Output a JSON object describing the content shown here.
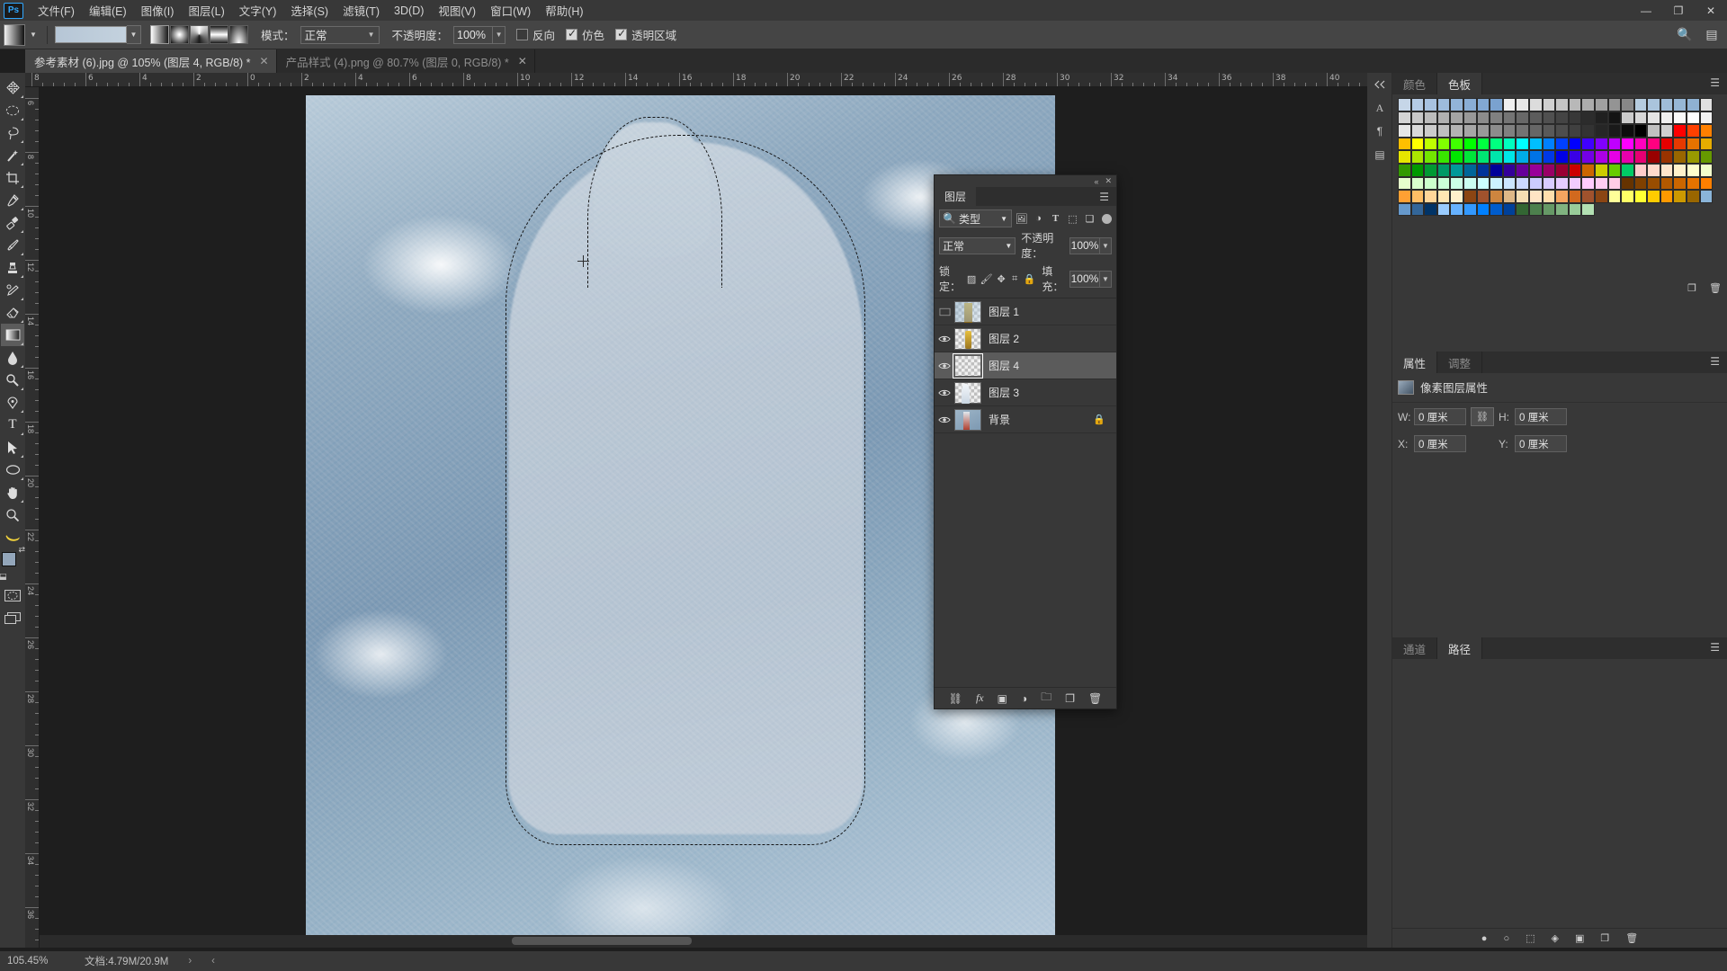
{
  "app": {
    "name": "Ps",
    "logo_color": "#31a8ff"
  },
  "menubar": {
    "items": [
      {
        "label": "文件(F)"
      },
      {
        "label": "编辑(E)"
      },
      {
        "label": "图像(I)"
      },
      {
        "label": "图层(L)"
      },
      {
        "label": "文字(Y)"
      },
      {
        "label": "选择(S)"
      },
      {
        "label": "滤镜(T)"
      },
      {
        "label": "3D(D)"
      },
      {
        "label": "视图(V)"
      },
      {
        "label": "窗口(W)"
      },
      {
        "label": "帮助(H)"
      }
    ],
    "window_controls": {
      "minimize": "—",
      "maximize": "❐",
      "close": "✕"
    }
  },
  "options_bar": {
    "tool": "gradient-tool",
    "mode_label": "模式：",
    "mode_value": "正常",
    "opacity_label": "不透明度：",
    "opacity_value": "100%",
    "checkboxes": [
      {
        "label": "反向",
        "checked": false
      },
      {
        "label": "仿色",
        "checked": true
      },
      {
        "label": "透明区域",
        "checked": true
      }
    ],
    "gradient_types": [
      "linear",
      "radial",
      "angle",
      "reflected",
      "diamond"
    ],
    "active_gradient_type": 0
  },
  "tabs": [
    {
      "title": "参考素材 (6).jpg @ 105% (图层 4, RGB/8) *",
      "active": true,
      "close": "✕"
    },
    {
      "title": "产品样式 (4).png @ 80.7% (图层 0, RGB/8) *",
      "active": false,
      "close": "✕"
    }
  ],
  "toolbar": {
    "tools": [
      {
        "name": "move-tool",
        "glyph": "✥"
      },
      {
        "name": "marquee-tool",
        "glyph": "◯"
      },
      {
        "name": "lasso-tool",
        "glyph": "◠"
      },
      {
        "name": "magic-wand-tool",
        "glyph": "✨"
      },
      {
        "name": "crop-tool",
        "glyph": "⌗"
      },
      {
        "name": "eyedropper-tool",
        "glyph": "✐"
      },
      {
        "name": "healing-brush-tool",
        "glyph": "✚"
      },
      {
        "name": "brush-tool",
        "glyph": "🖌"
      },
      {
        "name": "clone-stamp-tool",
        "glyph": "⚲"
      },
      {
        "name": "history-brush-tool",
        "glyph": "↯"
      },
      {
        "name": "eraser-tool",
        "glyph": "◨"
      },
      {
        "name": "gradient-tool",
        "glyph": "▦",
        "active": true
      },
      {
        "name": "blur-tool",
        "glyph": "💧"
      },
      {
        "name": "dodge-tool",
        "glyph": "◌"
      },
      {
        "name": "pen-tool",
        "glyph": "✒"
      },
      {
        "name": "type-tool",
        "glyph": "T"
      },
      {
        "name": "path-selection-tool",
        "glyph": "➤"
      },
      {
        "name": "ellipse-shape-tool",
        "glyph": "⬭"
      },
      {
        "name": "hand-tool",
        "glyph": "✋"
      },
      {
        "name": "zoom-tool",
        "glyph": "🔍"
      },
      {
        "name": "banana-tool",
        "glyph": "🍌"
      }
    ],
    "foreground_color": "#93a6ba",
    "background_color": "#b5b5b5"
  },
  "rulers": {
    "unit": "cm",
    "h_labels": [
      "6",
      "8",
      "10",
      "12",
      "14",
      "16",
      "18",
      "20",
      "22",
      "24",
      "26",
      "28",
      "30",
      "32",
      "34",
      "36",
      "38"
    ],
    "v_labels": [
      "6",
      "8",
      "10",
      "12",
      "14",
      "16",
      "18",
      "20",
      "22",
      "24",
      "26",
      "28",
      "30",
      "32",
      "34",
      "36"
    ]
  },
  "canvas": {
    "document": "参考素材 (6).jpg",
    "selection": "marching-ants-bottle-selection",
    "description": "ice texture background with bottle-shaped selection"
  },
  "color_panel": {
    "tabs": [
      {
        "label": "颜色",
        "active": false
      },
      {
        "label": "色板",
        "active": true
      }
    ],
    "swatch_rows": [
      [
        "#c6d6e8",
        "#b5cbe4",
        "#a8c2e0",
        "#9dbbdc",
        "#92b4d8",
        "#8aaed5",
        "#82a8d2",
        "#7aa2cf",
        "#f0f0f0",
        "#e8e8e8",
        "#dcdcdc",
        "#d0d0d0",
        "#c4c4c4",
        "#b8b8b8",
        "#acacac",
        "#a0a0a0",
        "#949494",
        "#888888",
        "#b6ccdf",
        "#aac4dc",
        "#a0bdd8",
        "#97b7d5",
        "#8fb1d2"
      ],
      [
        "#e0e0e0",
        "#d4d4d4",
        "#c8c8c8",
        "#bcbcbc",
        "#b0b0b0",
        "#a4a4a4",
        "#989898",
        "#8c8c8c",
        "#808080",
        "#747474",
        "#686868",
        "#5c5c5c",
        "#505050",
        "#444444",
        "#383838",
        "#2c2c2c",
        "#202020",
        "#141414",
        "#cccccc",
        "#d8d8d8",
        "#e4e4e4",
        "#f0f0f0",
        "#fafafa"
      ],
      [
        "#ffffff",
        "#f2f2f2",
        "#e6e6e6",
        "#d9d9d9",
        "#cccccc",
        "#bfbfbf",
        "#b3b3b3",
        "#a6a6a6",
        "#999999",
        "#8c8c8c",
        "#808080",
        "#737373",
        "#666666",
        "#595959",
        "#4d4d4d",
        "#404040",
        "#333333",
        "#262626",
        "#1a1a1a",
        "#0d0d0d",
        "#000000",
        "#c0c0c0",
        "#d0d0d0"
      ],
      [
        "#ff0000",
        "#ff4000",
        "#ff8000",
        "#ffbf00",
        "#ffff00",
        "#bfff00",
        "#80ff00",
        "#40ff00",
        "#00ff00",
        "#00ff40",
        "#00ff80",
        "#00ffbf",
        "#00ffff",
        "#00bfff",
        "#0080ff",
        "#0040ff",
        "#0000ff",
        "#4000ff",
        "#8000ff",
        "#bf00ff",
        "#ff00ff",
        "#ff00bf",
        "#ff0080"
      ],
      [
        "#e60000",
        "#e63900",
        "#e67300",
        "#e6ac00",
        "#e6e600",
        "#ace600",
        "#73e600",
        "#39e600",
        "#00e600",
        "#00e639",
        "#00e673",
        "#00e6ac",
        "#00e6e6",
        "#00ace6",
        "#0073e6",
        "#0039e6",
        "#0000e6",
        "#3900e6",
        "#7300e6",
        "#ac00e6",
        "#e600e6",
        "#e600ac",
        "#e60073"
      ],
      [
        "#990000",
        "#993300",
        "#996600",
        "#999900",
        "#669900",
        "#339900",
        "#009900",
        "#009933",
        "#009966",
        "#009999",
        "#006699",
        "#003399",
        "#000099",
        "#330099",
        "#660099",
        "#990099",
        "#990066",
        "#990033",
        "#cc0000",
        "#cc6600",
        "#cccc00",
        "#66cc00",
        "#00cc66"
      ],
      [
        "#ffcccc",
        "#ffd9cc",
        "#ffe6cc",
        "#fff2cc",
        "#ffffcc",
        "#f2ffcc",
        "#e6ffcc",
        "#d9ffcc",
        "#ccffcc",
        "#ccffd9",
        "#ccffe6",
        "#ccfff2",
        "#ccffff",
        "#ccf2ff",
        "#cce6ff",
        "#ccd9ff",
        "#ccccff",
        "#d9ccff",
        "#e6ccff",
        "#f2ccff",
        "#ffccff",
        "#ffccf2",
        "#ffcce6"
      ],
      [
        "#663300",
        "#804000",
        "#994d00",
        "#b35900",
        "#cc6600",
        "#e67300",
        "#ff8000",
        "#ffa033",
        "#ffbf66",
        "#ffd699",
        "#ffe6b3",
        "#fff0cc",
        "#8b4513",
        "#a0522d",
        "#cd853f",
        "#deb887",
        "#f5deb3",
        "#ffe4c4",
        "#ffdead",
        "#f4a460",
        "#d2691e",
        "#a0522d",
        "#8b4513"
      ],
      [
        "#ffff99",
        "#ffff66",
        "#ffff33",
        "#ffcc00",
        "#ff9900",
        "#cc9900",
        "#996600",
        "#8ab4d8",
        "#6699cc",
        "#336699",
        "#003366",
        "#99ccff",
        "#66b2ff",
        "#3399ff",
        "#0080ff",
        "#005ccc",
        "#004099",
        "#336633",
        "#4d804d",
        "#669966",
        "#80b380",
        "#99cc99",
        "#b3e0b3"
      ]
    ]
  },
  "layers_panel": {
    "title": "图层",
    "filter_kind": "类型",
    "filter_icons": [
      "image-filter-icon",
      "adjustment-filter-icon",
      "type-filter-icon",
      "shape-filter-icon",
      "smartobject-filter-icon"
    ],
    "blend_mode": "正常",
    "opacity_label": "不透明度：",
    "opacity_value": "100%",
    "lock_label": "锁定：",
    "lock_icons": [
      "lock-transparency-icon",
      "lock-image-icon",
      "lock-position-icon",
      "lock-artboard-icon",
      "lock-all-icon"
    ],
    "fill_label": "填充：",
    "fill_value": "100%",
    "layers": [
      {
        "name": "图层 1",
        "visible": false,
        "selected": false,
        "locked": false,
        "thumb": "bottle-on-ice"
      },
      {
        "name": "图层 2",
        "visible": true,
        "selected": false,
        "locked": false,
        "thumb": "bottle-yellow"
      },
      {
        "name": "图层 4",
        "visible": true,
        "selected": true,
        "locked": false,
        "thumb": "empty-transparent"
      },
      {
        "name": "图层 3",
        "visible": true,
        "selected": false,
        "locked": false,
        "thumb": "white-shape"
      },
      {
        "name": "背景",
        "visible": true,
        "selected": false,
        "locked": true,
        "thumb": "ice-photo"
      }
    ],
    "footer_buttons": [
      "link-layers-icon",
      "layer-style-fx-icon",
      "add-mask-icon",
      "adjustment-layer-icon",
      "new-group-icon",
      "new-layer-icon",
      "delete-layer-icon"
    ]
  },
  "properties_panel": {
    "tabs": [
      {
        "label": "属性",
        "active": true
      },
      {
        "label": "调整",
        "active": false
      }
    ],
    "heading": "像素图层属性",
    "fields": [
      {
        "label": "W:",
        "value": "0 厘米"
      },
      {
        "label": "H:",
        "value": "0 厘米"
      },
      {
        "label": "X:",
        "value": "0 厘米"
      },
      {
        "label": "Y:",
        "value": "0 厘米"
      }
    ],
    "link_icon": "link-wh-icon"
  },
  "paths_panel": {
    "tabs": [
      {
        "label": "通道",
        "active": false
      },
      {
        "label": "路径",
        "active": true
      }
    ],
    "footer_buttons": [
      "fill-path-icon",
      "stroke-path-icon",
      "load-selection-icon",
      "make-workpath-icon",
      "add-mask-icon",
      "new-path-icon",
      "delete-path-icon"
    ]
  },
  "status_bar": {
    "zoom": "105.45%",
    "doc_info": "文档:4.79M/20.9M",
    "arrow": "›"
  }
}
